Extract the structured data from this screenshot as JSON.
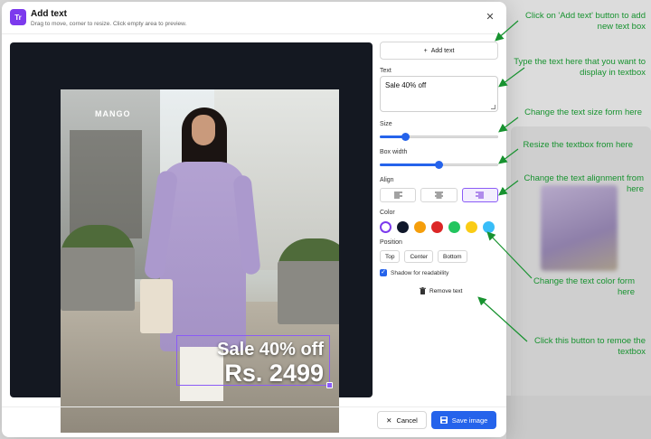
{
  "dialog": {
    "icon_label": "Tr",
    "title": "Add text",
    "subtitle": "Drag to move, corner to resize. Click empty area to preview."
  },
  "background": {
    "store_sign": "MANGO"
  },
  "overlay": {
    "line1": "Sale 40% off",
    "line2": "Rs. 2499"
  },
  "panel": {
    "add_text_label": "Add text",
    "text_label": "Text",
    "text_value": "Sale 40% off",
    "size_label": "Size",
    "size_level": 0.2,
    "box_width_label": "Box width",
    "box_width_level": 0.5,
    "align_label": "Align",
    "align_options": [
      "left",
      "center",
      "right"
    ],
    "align_selected": "right",
    "color_label": "Color",
    "colors": [
      "#ffffff",
      "#0f172a",
      "#f59e0b",
      "#dc2626",
      "#22c55e",
      "#facc15",
      "#38bdf8"
    ],
    "color_selected": "#ffffff",
    "position_label": "Position",
    "positions": [
      "Top",
      "Center",
      "Bottom"
    ],
    "shadow_label": "Shadow for readability",
    "shadow_checked": true,
    "remove_label": "Remove text"
  },
  "footer": {
    "cancel_label": "Cancel",
    "save_label": "Save image"
  },
  "annotations": {
    "add_text": "Click on 'Add text' button to add new text box",
    "type_text": "Type the text here that you want to display in textbox",
    "size": "Change the text size form here",
    "box_width": "Resize the textbox from here",
    "align": "Change the text alignment from here",
    "color": "Change the text color form here",
    "remove": "Click this button to remoe the textbox"
  }
}
